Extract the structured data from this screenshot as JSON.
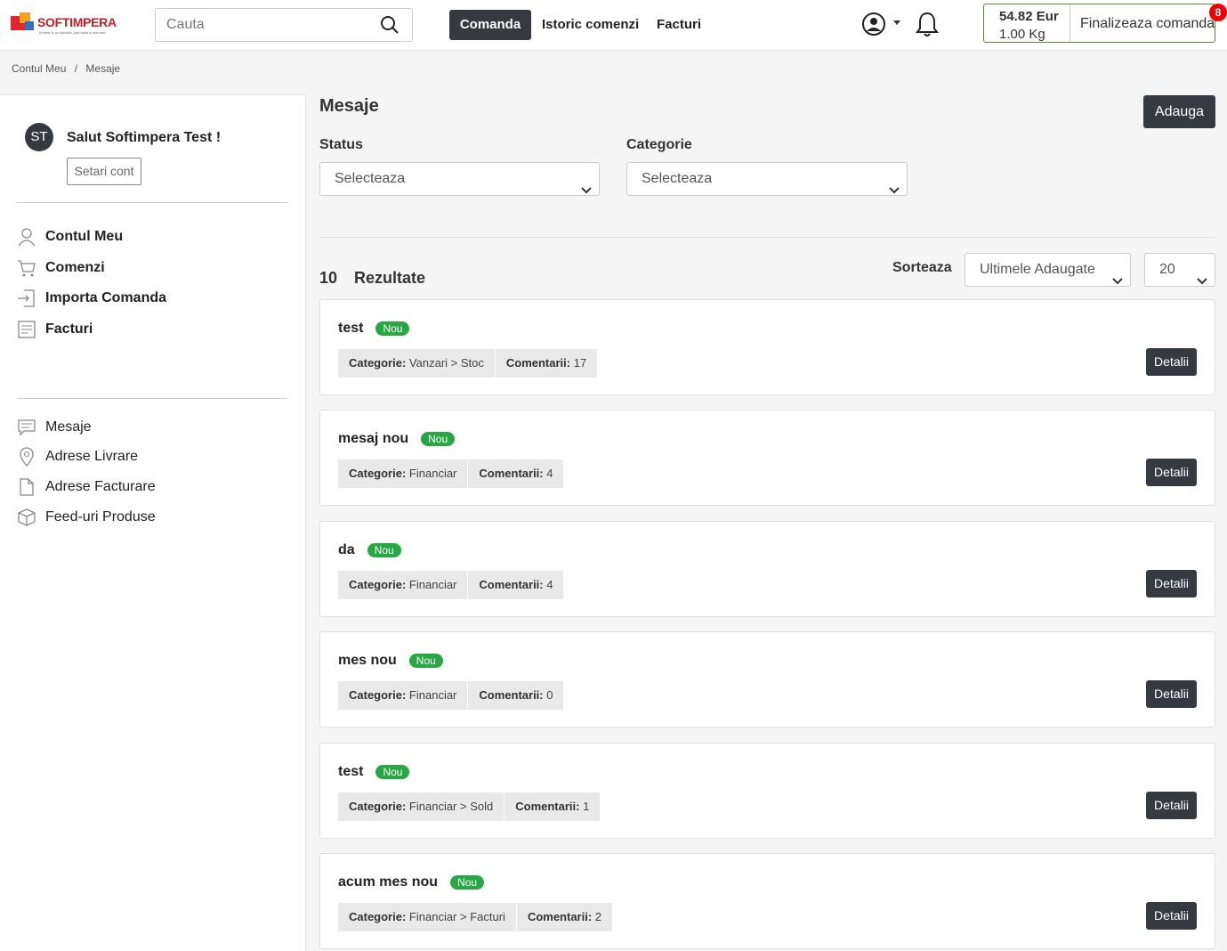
{
  "header": {
    "logo_text": "SOFTIMPERA",
    "logo_tagline": "If there is no solution, just build a new one",
    "search_placeholder": "Cauta",
    "nav": [
      "Comanda",
      "Istoric comenzi",
      "Facturi"
    ],
    "cart": {
      "price": "54.82 Eur",
      "weight": "1.00 Kg",
      "finish_label": "Finalizeaza comanda",
      "badge": "8"
    }
  },
  "breadcrumb": [
    "Contul Meu",
    "/",
    "Mesaje"
  ],
  "sidebar": {
    "avatar": "ST",
    "greeting": "Salut Softimpera Test !",
    "settings": "Setari cont",
    "primary": [
      "Contul Meu",
      "Comenzi",
      "Importa Comanda",
      "Facturi"
    ],
    "secondary": [
      "Mesaje",
      "Adrese Livrare",
      "Adrese Facturare",
      "Feed-uri Produse"
    ]
  },
  "main": {
    "title": "Mesaje",
    "add": "Adauga",
    "status_label": "Status",
    "status_value": "Selecteaza",
    "category_label": "Categorie",
    "category_value": "Selecteaza",
    "results_count": "10",
    "results_label": "Rezultate",
    "sort_label": "Sorteaza",
    "sort_value": "Ultimele Adaugate",
    "per_page": "20",
    "badge_new": "Nou",
    "category_prefix": "Categorie:",
    "comments_prefix": "Comentarii:",
    "details": "Detalii",
    "messages": [
      {
        "title": "test",
        "category": "Vanzari > Stoc",
        "comments": "17"
      },
      {
        "title": "mesaj nou",
        "category": "Financiar",
        "comments": "4"
      },
      {
        "title": "da",
        "category": "Financiar",
        "comments": "4"
      },
      {
        "title": "mes nou",
        "category": "Financiar",
        "comments": "0"
      },
      {
        "title": "test",
        "category": "Financiar > Sold",
        "comments": "1"
      },
      {
        "title": "acum mes nou",
        "category": "Financiar > Facturi",
        "comments": "2"
      }
    ]
  },
  "colors": {
    "dark": "#343a40",
    "green": "#28a745",
    "red": "#e3262b"
  }
}
